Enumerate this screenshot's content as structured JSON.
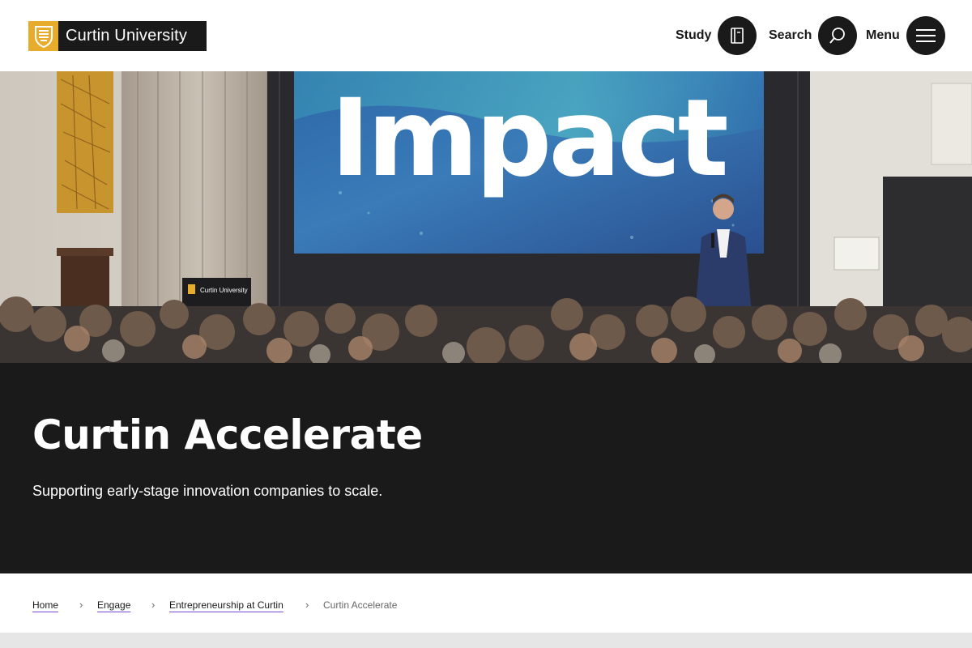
{
  "header": {
    "logo_text": "Curtin University",
    "nav": [
      {
        "label": "Study",
        "icon": "book-icon"
      },
      {
        "label": "Search",
        "icon": "search-icon"
      },
      {
        "label": "Menu",
        "icon": "hamburger-menu-icon"
      }
    ]
  },
  "hero": {
    "screen_text": "Impact",
    "podium_text": "Curtin University"
  },
  "page": {
    "title": "Curtin Accelerate",
    "subtitle": "Supporting early-stage innovation companies to scale."
  },
  "breadcrumb": {
    "items": [
      {
        "label": "Home"
      },
      {
        "label": "Engage"
      },
      {
        "label": "Entrepreneurship at Curtin"
      },
      {
        "label": "Curtin Accelerate"
      }
    ],
    "separator": "›"
  },
  "colors": {
    "brand_gold": "#e7ac2c",
    "dark": "#1a1a1a",
    "link_underline": "#7a4ad9",
    "footer_grey": "#e6e6e6"
  }
}
